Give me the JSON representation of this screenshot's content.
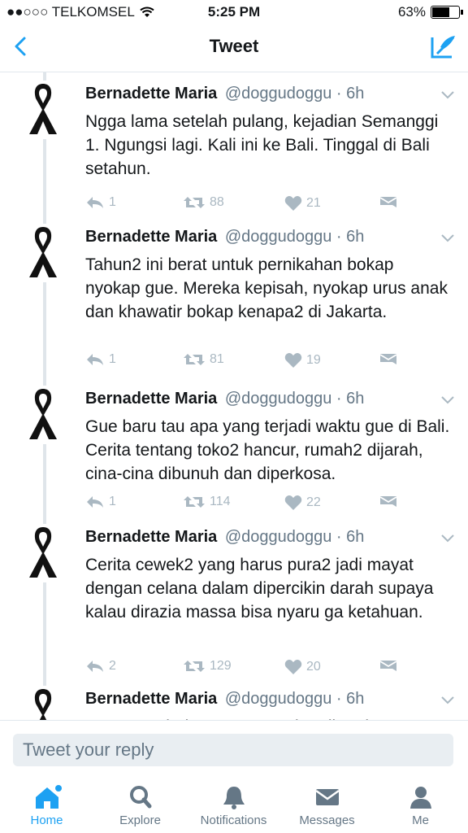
{
  "status_bar": {
    "carrier": "●●○○○ TELKOMSEL",
    "time": "5:25 PM",
    "battery": "63%"
  },
  "nav": {
    "title": "Tweet",
    "back_icon": "chevron-left-icon",
    "compose_icon": "compose-icon"
  },
  "tweets": [
    {
      "name": "Bernadette Maria",
      "handle": "@doggudoggu · 6h",
      "text": "Ngga lama setelah pulang, kejadian Semanggi 1. Ngungsi lagi. Kali ini ke Bali. Tinggal di Bali setahun.",
      "replies": "1",
      "retweets": "88",
      "likes": "21"
    },
    {
      "name": "Bernadette Maria",
      "handle": "@doggudoggu · 6h",
      "text": "Tahun2 ini berat untuk pernikahan bokap nyokap gue. Mereka kepisah, nyokap urus anak dan khawatir bokap kenapa2 di Jakarta.",
      "replies": "1",
      "retweets": "81",
      "likes": "19"
    },
    {
      "name": "Bernadette Maria",
      "handle": "@doggudoggu · 6h",
      "text": "Gue baru tau apa yang terjadi waktu gue di Bali. Cerita tentang toko2 hancur, rumah2 dijarah, cina-cina dibunuh dan diperkosa.",
      "replies": "1",
      "retweets": "114",
      "likes": "22"
    },
    {
      "name": "Bernadette Maria",
      "handle": "@doggudoggu · 6h",
      "text": "Cerita cewek2 yang harus pura2 jadi mayat dengan celana dalam dipercikin darah supaya kalau dirazia massa bisa nyaru ga ketahuan.",
      "replies": "2",
      "retweets": "129",
      "likes": "20"
    },
    {
      "name": "Bernadette Maria",
      "handle": "@doggudoggu · 6h",
      "text": "Karyawan bokap gue, cewek, pribumi",
      "replies": "",
      "retweets": "",
      "likes": ""
    }
  ],
  "reply": {
    "placeholder": "Tweet your reply"
  },
  "tabs": [
    {
      "label": "Home",
      "icon": "home-icon",
      "active": true
    },
    {
      "label": "Explore",
      "icon": "search-icon",
      "active": false
    },
    {
      "label": "Notifications",
      "icon": "bell-icon",
      "active": false
    },
    {
      "label": "Messages",
      "icon": "envelope-icon",
      "active": false
    },
    {
      "label": "Me",
      "icon": "person-icon",
      "active": false
    }
  ],
  "colors": {
    "accent": "#1da1f2",
    "muted": "#aab8c2",
    "text": "#14171a",
    "secondary": "#657786"
  }
}
